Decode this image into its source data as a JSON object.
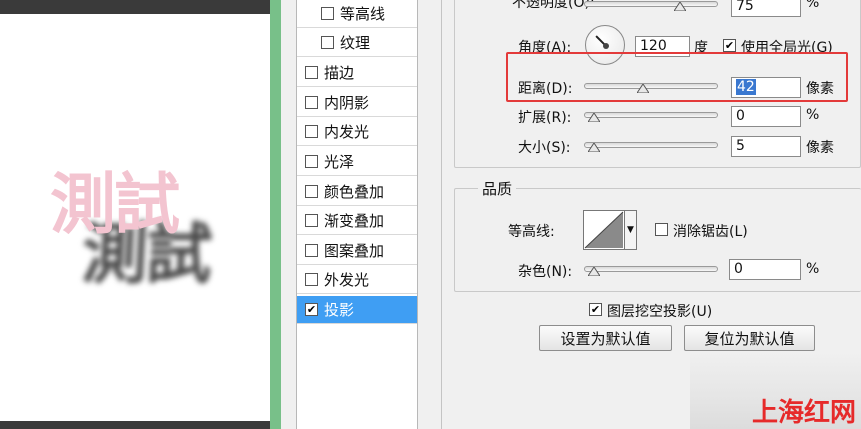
{
  "preview": {
    "sample_text": "測試"
  },
  "styles_list": {
    "items": [
      {
        "label": "等高线",
        "checked": false,
        "sub": true
      },
      {
        "label": "纹理",
        "checked": false,
        "sub": true
      },
      {
        "label": "描边",
        "checked": false,
        "sub": false
      },
      {
        "label": "内阴影",
        "checked": false,
        "sub": false
      },
      {
        "label": "内发光",
        "checked": false,
        "sub": false
      },
      {
        "label": "光泽",
        "checked": false,
        "sub": false
      },
      {
        "label": "颜色叠加",
        "checked": false,
        "sub": false
      },
      {
        "label": "渐变叠加",
        "checked": false,
        "sub": false
      },
      {
        "label": "图案叠加",
        "checked": false,
        "sub": false
      },
      {
        "label": "外发光",
        "checked": false,
        "sub": false
      },
      {
        "label": "投影",
        "checked": true,
        "sub": false,
        "selected": true
      }
    ]
  },
  "structure": {
    "opacity": {
      "label": "不透明度(O):",
      "value": "75",
      "unit": "%",
      "level": 0.75
    },
    "angle": {
      "label": "角度(A):",
      "value": "120",
      "unit": "度"
    },
    "use_global_light": {
      "label": "使用全局光(G)",
      "checked": true
    },
    "distance": {
      "label": "距离(D):",
      "value": "42",
      "unit": "像素"
    },
    "spread": {
      "label": "扩展(R):",
      "value": "0",
      "unit": "%",
      "level": 0
    },
    "size": {
      "label": "大小(S):",
      "value": "5",
      "unit": "像素"
    }
  },
  "quality": {
    "title": "品质",
    "contour_label": "等高线:",
    "anti_alias": {
      "label": "消除锯齿(L)",
      "checked": false
    },
    "noise": {
      "label": "杂色(N):",
      "value": "0",
      "unit": "%",
      "level": 0
    }
  },
  "layer_knockout": {
    "label": "图层挖空投影(U)",
    "checked": true
  },
  "buttons": {
    "make_default": "设置为默认值",
    "reset_default": "复位为默认值"
  },
  "watermark": "上海红网",
  "colors": {
    "accent_selected": "#3f9ef3",
    "highlight_box": "#e33a3a",
    "divider": "#78c089"
  }
}
